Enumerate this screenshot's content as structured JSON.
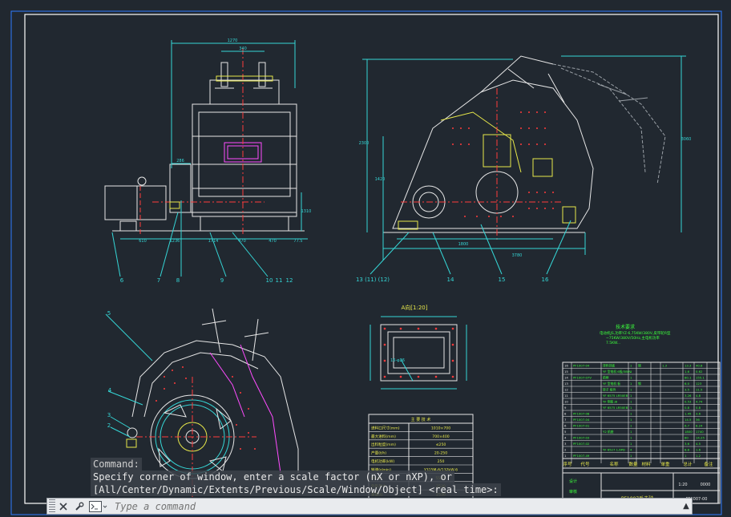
{
  "drawing": {
    "dims": {
      "front_width": "1270",
      "front_top": "340",
      "front_motor": "286",
      "front_height": "1310",
      "front_b1": "610",
      "front_b2": "1236",
      "front_b3": "1714",
      "front_b4": "470",
      "front_b5": "470",
      "front_b6": "77.5",
      "side_height": "2300",
      "side_h2": "1420",
      "side_right": "3060",
      "side_b1": "1800",
      "side_b2": "3780",
      "view_a_title": "A向[1:20]",
      "view_a_label": "16-φ26"
    },
    "callouts": [
      "6",
      "7",
      "8",
      "9",
      "10",
      "11",
      "12",
      "13 (11) (12)",
      "14",
      "15",
      "16",
      "5",
      "4",
      "3",
      "2"
    ],
    "notes_title": "技术要求",
    "notes_lines": [
      "电动机JS,功率YZ-6,75KW/380V,皮带轮R型",
      "~75KW/380V/50Hz,主电机功率",
      "7.5KW..."
    ],
    "spec_table": {
      "title": "主 要 技 术",
      "rows": [
        [
          "进料口尺寸(mm)",
          "1010×700"
        ],
        [
          "最大进料(mm)",
          "700×400"
        ],
        [
          "出料粒度(mm)",
          "≤250"
        ],
        [
          "产量(t/h)",
          "20-250"
        ],
        [
          "电机功率(kW)",
          "250"
        ],
        [
          "转速(r/min)",
          "Y315M-6/132kW-6"
        ],
        [
          "P(kW)",
          "55/75"
        ],
        [
          "外形尺寸",
          "2530"
        ],
        [
          "重量(t)",
          "2530"
        ]
      ]
    },
    "parts": [
      [
        "16",
        "PF1007-04",
        "排料挡板",
        "1",
        "钢",
        "",
        "1.3",
        "13.3",
        "40.8"
      ],
      [
        "15",
        "",
        "YF 型电机 6极/380V",
        "1",
        "",
        "",
        "",
        "1.6",
        "0.62"
      ],
      [
        "14",
        "PF1007-07V",
        "前框",
        "1",
        "",
        "",
        "",
        "80.1",
        "155.1"
      ],
      [
        "13",
        "",
        "YF 型电机 板",
        "1",
        "钢",
        "",
        "",
        "6.0",
        "123"
      ],
      [
        "12",
        "",
        "转子 组件",
        "1",
        "",
        "",
        "",
        "3.5",
        "11.5"
      ],
      [
        "11",
        "",
        "YF 6575 LR50EB",
        "1",
        "",
        "",
        "",
        "3.26",
        "4.8"
      ],
      [
        "10",
        "",
        "YF 侧板 J8",
        "1",
        "",
        "",
        "",
        "0.53",
        "4.74"
      ],
      [
        "9",
        "",
        "YF 6575 LR50EB",
        "1",
        "",
        "",
        "",
        "0.8",
        "0.8"
      ],
      [
        "8",
        "PF1007-08",
        "",
        "1",
        "",
        "",
        "",
        "1.45",
        "3.6"
      ],
      [
        "7",
        "PF1007-04",
        "",
        "1",
        "",
        "",
        "",
        "14.5",
        "36"
      ],
      [
        "6",
        "PF1007-01",
        "",
        "1",
        "",
        "",
        "",
        "6.7",
        "8.24"
      ],
      [
        "5",
        "",
        "Y2 机座",
        "1",
        "",
        "",
        "",
        "1800",
        "1740"
      ],
      [
        "4",
        "PF1007-03",
        "",
        "1",
        "",
        "",
        "",
        "80",
        "14.25"
      ],
      [
        "3",
        "PF1007-02",
        "",
        "1",
        "",
        "",
        "",
        "3.6",
        "4.5"
      ],
      [
        "2",
        "",
        "YF 6527 1.6PD",
        "4",
        "",
        "",
        "",
        "8.8",
        "1.6"
      ],
      [
        "1",
        "PF1007-49",
        "",
        "1",
        "",
        "",
        "",
        "1",
        "1.2"
      ]
    ],
    "header_cols": [
      "序号",
      "代号",
      "名称",
      "数量",
      "材料",
      "单重",
      "总计",
      "备注"
    ],
    "title_block": {
      "designer": "设计",
      "checker": "审核",
      "name": "PF1007反击破",
      "drawing_no": "PF1007-00",
      "scale": "1:20",
      "mark": "1:20",
      "sheet": "0000"
    }
  },
  "command": {
    "history": [
      "Command:",
      "Specify corner of window, enter a scale factor (nX or nXP), or",
      "[All/Center/Dynamic/Extents/Previous/Scale/Window/Object] <real time>:"
    ],
    "placeholder": "Type a command",
    "close_icon": "close-icon",
    "settings_icon": "wrench-icon",
    "prompt_icon": "command-prompt-icon"
  },
  "colors": {
    "background": "#212830",
    "line": "#e6e6e6",
    "cyan": "#35d6d6",
    "red": "#ff3b3b",
    "yellow": "#e8e84a",
    "magenta": "#ff4cff",
    "green": "#3cff3c",
    "frame": "#2f7bff"
  }
}
